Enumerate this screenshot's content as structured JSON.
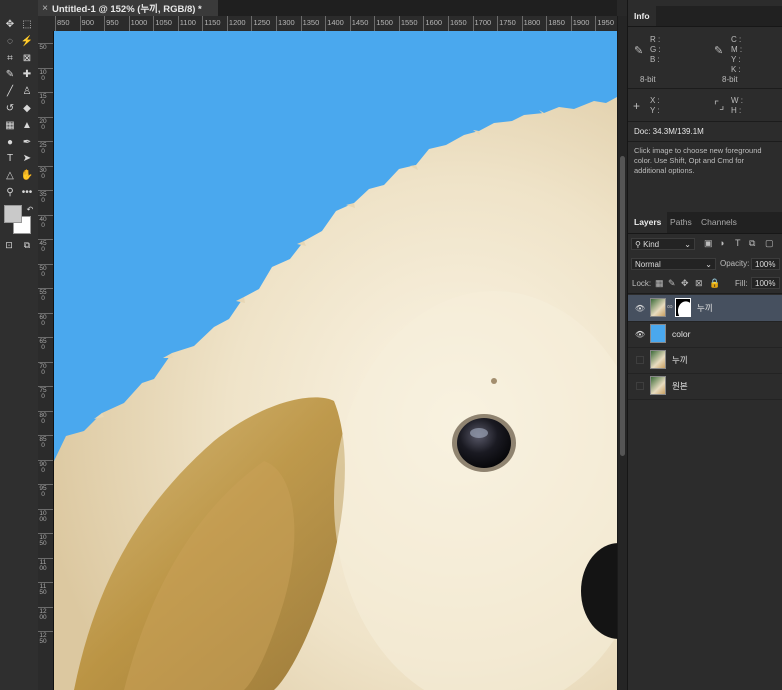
{
  "document": {
    "tab_title": "Untitled-1 @ 152% (누끼, RGB/8) *",
    "close_glyph": "×"
  },
  "ruler": {
    "horizontal": [
      "850",
      "900",
      "950",
      "1000",
      "1050",
      "1100",
      "1150",
      "1200",
      "1250",
      "1300",
      "1350",
      "1400",
      "1450",
      "1500",
      "1550",
      "1600",
      "1650",
      "1700",
      "1750",
      "1800",
      "1850",
      "1900",
      "1950"
    ],
    "vertical": [
      "50",
      "100",
      "150",
      "200",
      "250",
      "300",
      "350",
      "400",
      "450",
      "500",
      "550",
      "600",
      "650",
      "700",
      "750",
      "800",
      "850",
      "900",
      "950",
      "1000",
      "1050",
      "1100",
      "1150",
      "1200",
      "1250"
    ]
  },
  "tools": [
    {
      "name": "move-icon",
      "glyph": "✥"
    },
    {
      "name": "marquee-icon",
      "glyph": "⬚"
    },
    {
      "name": "lasso-icon",
      "glyph": "◌"
    },
    {
      "name": "magic-wand-icon",
      "glyph": "⚡"
    },
    {
      "name": "crop-icon",
      "glyph": "⌗"
    },
    {
      "name": "frame-icon",
      "glyph": "⊠"
    },
    {
      "name": "eyedropper-icon",
      "glyph": "✎"
    },
    {
      "name": "healing-brush-icon",
      "glyph": "✚"
    },
    {
      "name": "brush-icon",
      "glyph": "╱"
    },
    {
      "name": "stamp-icon",
      "glyph": "♙"
    },
    {
      "name": "history-brush-icon",
      "glyph": "↺"
    },
    {
      "name": "eraser-icon",
      "glyph": "◆"
    },
    {
      "name": "gradient-icon",
      "glyph": "▦"
    },
    {
      "name": "blur-icon",
      "glyph": "▲"
    },
    {
      "name": "dodge-icon",
      "glyph": "●"
    },
    {
      "name": "pen-icon",
      "glyph": "✒"
    },
    {
      "name": "type-icon",
      "glyph": "T"
    },
    {
      "name": "path-select-icon",
      "glyph": "➤"
    },
    {
      "name": "shape-icon",
      "glyph": "△"
    },
    {
      "name": "hand-icon",
      "glyph": "✋"
    },
    {
      "name": "zoom-icon",
      "glyph": "⚲"
    },
    {
      "name": "more-tools-icon",
      "glyph": "•••"
    }
  ],
  "info": {
    "tab_label": "Info",
    "rgb_labels": [
      "R :",
      "G :",
      "B :"
    ],
    "cmyk_labels": [
      "C :",
      "M :",
      "Y :",
      "K :"
    ],
    "bit_left": "8-bit",
    "bit_right": "8-bit",
    "xy_labels": [
      "X :",
      "Y :"
    ],
    "wh_labels": [
      "W :",
      "H :"
    ],
    "doc_size": "Doc: 34.3M/139.1M",
    "hint": "Click image to choose new foreground color.  Use Shift, Opt and Cmd for additional options."
  },
  "layers": {
    "tabs": [
      "Layers",
      "Paths",
      "Channels"
    ],
    "filter_kind": "Kind",
    "blend_mode": "Normal",
    "opacity_label": "Opacity:",
    "opacity_value": "100%",
    "lock_label": "Lock:",
    "fill_label": "Fill:",
    "fill_value": "100%",
    "items": [
      {
        "name": "누끼",
        "visible": true,
        "selected": true,
        "has_mask": true
      },
      {
        "name": "color",
        "visible": true,
        "selected": false,
        "has_mask": false
      },
      {
        "name": "누끼",
        "visible": false,
        "selected": false,
        "has_mask": false
      },
      {
        "name": "원본",
        "visible": false,
        "selected": false,
        "has_mask": false
      }
    ]
  },
  "colors": {
    "canvas_bg": "#4aa8ee",
    "selected_layer": "#46505f",
    "fur": "#efe4cc",
    "fur_shadow": "#b8903a"
  }
}
